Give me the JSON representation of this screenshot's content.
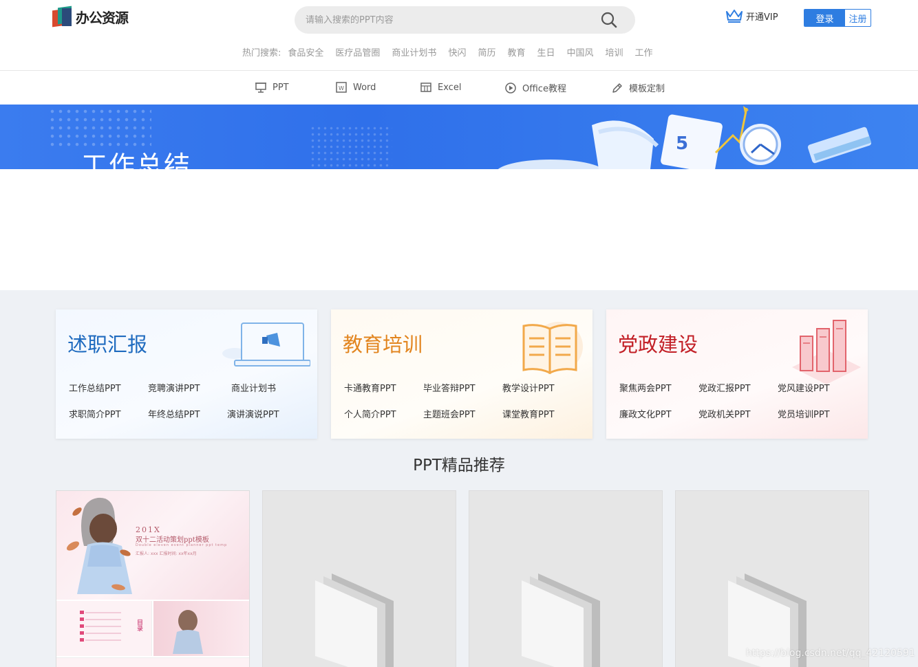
{
  "header": {
    "logo_text": "办公资源",
    "search_placeholder": "请输入搜索的PPT内容",
    "vip_label": "开通VIP",
    "login_label": "登录",
    "register_label": "注册",
    "hot_label": "热门搜索:",
    "hot_items": [
      "食品安全",
      "医疗品管圈",
      "商业计划书",
      "快闪",
      "简历",
      "教育",
      "生日",
      "中国风",
      "培训",
      "工作"
    ]
  },
  "nav": {
    "items": [
      {
        "label": "PPT",
        "icon": "presentation-icon"
      },
      {
        "label": "Word",
        "icon": "word-icon"
      },
      {
        "label": "Excel",
        "icon": "excel-icon"
      },
      {
        "label": "Office教程",
        "icon": "play-icon"
      },
      {
        "label": "模板定制",
        "icon": "pen-icon"
      }
    ]
  },
  "banner": {
    "title": "工作总结"
  },
  "categories": [
    {
      "title": "述职汇报",
      "links": [
        "工作总结PPT",
        "竞聘演讲PPT",
        "商业计划书",
        "求职简介PPT",
        "年终总结PPT",
        "演讲演说PPT"
      ]
    },
    {
      "title": "教育培训",
      "links": [
        "卡通教育PPT",
        "毕业答辩PPT",
        "教学设计PPT",
        "个人简介PPT",
        "主题班会PPT",
        "课堂教育PPT"
      ]
    },
    {
      "title": "党政建设",
      "links": [
        "聚焦两会PPT",
        "党政汇报PPT",
        "党风建设PPT",
        "廉政文化PPT",
        "党政机关PPT",
        "党员培训PPT"
      ]
    }
  ],
  "recommend": {
    "title": "PPT精品推荐",
    "first_template": {
      "year": "201X",
      "title": "双十二活动策划ppt模板",
      "subtitle": "Double eleven event planner ppt temp",
      "meta": "汇报人: xxx    汇报时间: xx年xx月",
      "toc_label": "目录"
    }
  },
  "watermark": "https://blog.csdn.net/qq_42120591",
  "colors": {
    "brand_blue": "#2e7de1",
    "banner_blue": "#3b7cef",
    "report_blue": "#1f6bbf",
    "education_orange": "#e2851f",
    "party_red": "#c21f26"
  }
}
